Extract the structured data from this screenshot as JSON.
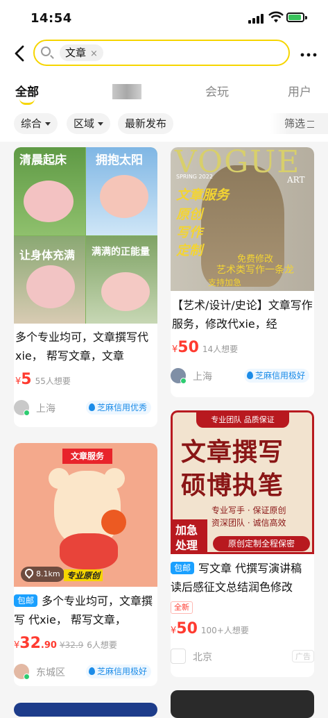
{
  "status_bar": {
    "time": "14:54"
  },
  "search": {
    "query": "文章",
    "clear_icon": "×"
  },
  "tabs": [
    {
      "label": "全部",
      "active": true
    },
    {
      "label": "",
      "active": false
    },
    {
      "label": "会玩",
      "active": false
    },
    {
      "label": "用户",
      "active": false
    }
  ],
  "filters": {
    "comprehensive": "综合",
    "region": "区域",
    "latest": "最新发布",
    "screen": "筛选"
  },
  "cards": [
    {
      "image_texts": [
        "清晨起床",
        "拥抱太阳",
        "让身体充满",
        "满满的正能量"
      ],
      "title": "多个专业均可，文章撰写代xie， 帮写文章，文章",
      "price_currency": "¥",
      "price_int": "5",
      "price_dec": "",
      "orig_price": "",
      "wants": "55人想要",
      "location": "上海",
      "credit": "芝麻信用优秀"
    },
    {
      "image_texts": [
        "VOGUE",
        "SPRING 2022",
        "ART",
        "文章服务",
        "原创",
        "写作",
        "定制",
        "免费修改",
        "艺术类写作一条龙",
        "支持加急"
      ],
      "title": "【艺术/设计/史论】文章写作服务，修改代xie，经",
      "price_currency": "¥",
      "price_int": "50",
      "price_dec": "",
      "orig_price": "",
      "wants": "14人想要",
      "location": "上海",
      "credit": "芝麻信用极好"
    },
    {
      "image_texts": [
        "文章服务",
        "8.1km",
        "专业原创"
      ],
      "badge": "包邮",
      "title": "多个专业均可，文章撰写 代xie， 帮写文章，",
      "price_currency": "¥",
      "price_int": "32",
      "price_dec": ".90",
      "orig_price": "¥32.9",
      "wants": "6人想要",
      "location": "东城区",
      "credit": "芝麻信用极好"
    },
    {
      "image_texts": [
        "专业团队 品质保证",
        "文章撰写",
        "硕博执笔",
        "专业写手 · 保证原创",
        "资深团队 · 诚信高效",
        "加急",
        "处理",
        "原创定制全程保密"
      ],
      "badge": "包邮",
      "title": "写文章 代撰写演讲稿读后感征文总结润色修改",
      "new_tag": "全新",
      "price_currency": "¥",
      "price_int": "50",
      "price_dec": "",
      "orig_price": "",
      "wants": "100+人想要",
      "location": "北京",
      "ad": "广告"
    }
  ],
  "colors": {
    "accent_yellow": "#f6d500",
    "price_red": "#ff3b30",
    "credit_blue": "#1c8ce8"
  },
  "icons": [
    "back-icon",
    "search-icon",
    "more-icon",
    "signal-icon",
    "wifi-icon",
    "battery-icon",
    "filter-icon",
    "location-pin-icon"
  ]
}
